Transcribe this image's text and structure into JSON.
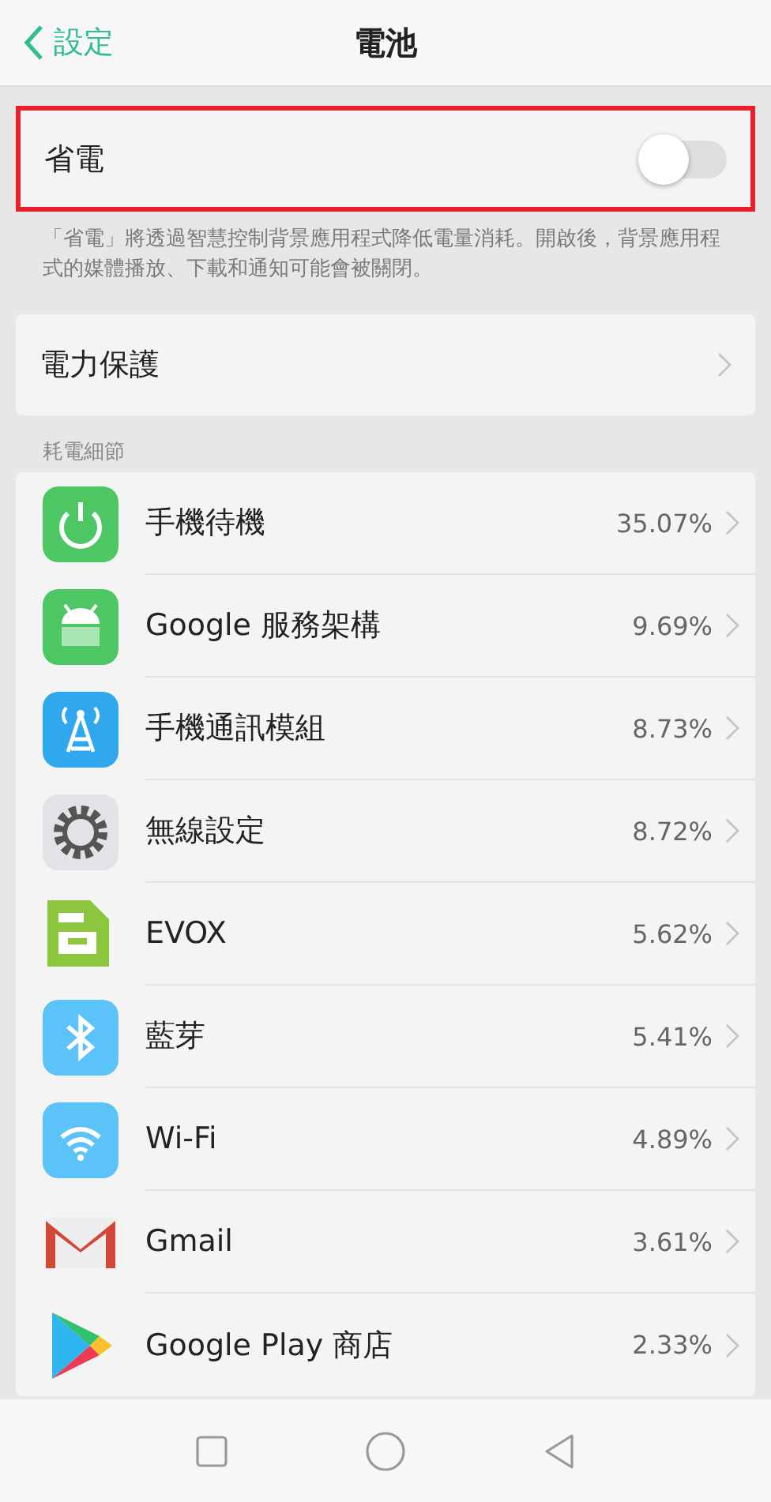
{
  "header": {
    "back_label": "設定",
    "title": "電池"
  },
  "power_saving": {
    "label": "省電",
    "on": false,
    "highlighted": true
  },
  "description": "「省電」將透過智慧控制背景應用程式降低電量消耗。開啟後，背景應用程式的媒體播放、下載和通知可能會被關閉。",
  "protection": {
    "label": "電力保護"
  },
  "usage_section": {
    "title": "耗電細節",
    "items": [
      {
        "name": "手機待機",
        "percent": "35.07%"
      },
      {
        "name": "Google 服務架構",
        "percent": "9.69%"
      },
      {
        "name": "手機通訊模組",
        "percent": "8.73%"
      },
      {
        "name": "無線設定",
        "percent": "8.72%"
      },
      {
        "name": "EVOX",
        "percent": "5.62%"
      },
      {
        "name": "藍芽",
        "percent": "5.41%"
      },
      {
        "name": "Wi-Fi",
        "percent": "4.89%"
      },
      {
        "name": "Gmail",
        "percent": "3.61%"
      },
      {
        "name": "Google Play 商店",
        "percent": "2.33%"
      }
    ]
  }
}
